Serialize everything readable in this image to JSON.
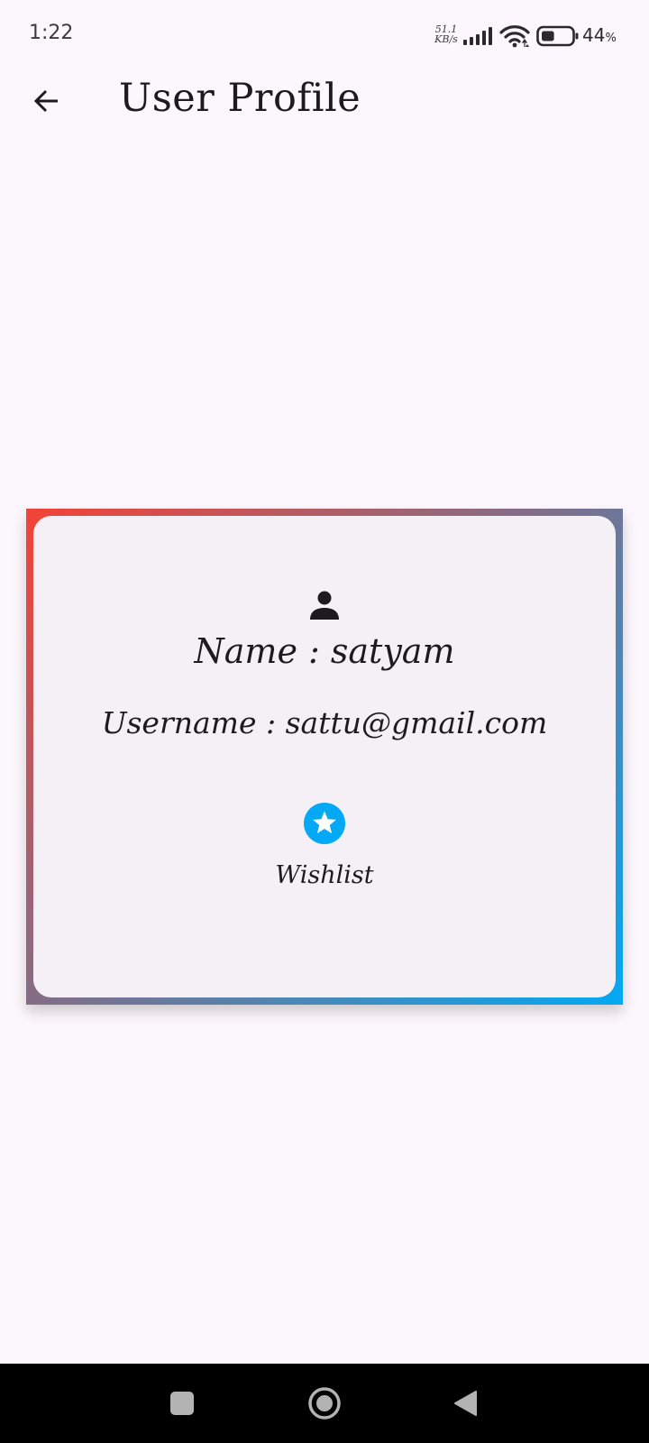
{
  "status_bar": {
    "time": "1:22",
    "net_speed_value": "51.1",
    "net_speed_unit": "KB/s",
    "battery_percent": "44",
    "battery_unit": "%",
    "battery_level": 0.44,
    "icons": [
      "signal-icon",
      "wifi-icon",
      "battery-icon"
    ]
  },
  "app_bar": {
    "back_icon": "arrow-back-icon",
    "title": "User Profile"
  },
  "profile_card": {
    "icon": "person-icon",
    "name_line": "Name : satyam",
    "username_line": "Username : sattu@gmail.com",
    "wishlist_icon": "star-circle-icon",
    "wishlist_label": "Wishlist",
    "border_gradient": [
      "#f44336",
      "#03a9f4"
    ],
    "accent_color": "#03a9f4"
  },
  "nav_bar": {
    "icons": [
      "recents-square-icon",
      "home-circle-icon",
      "back-triangle-icon"
    ]
  }
}
